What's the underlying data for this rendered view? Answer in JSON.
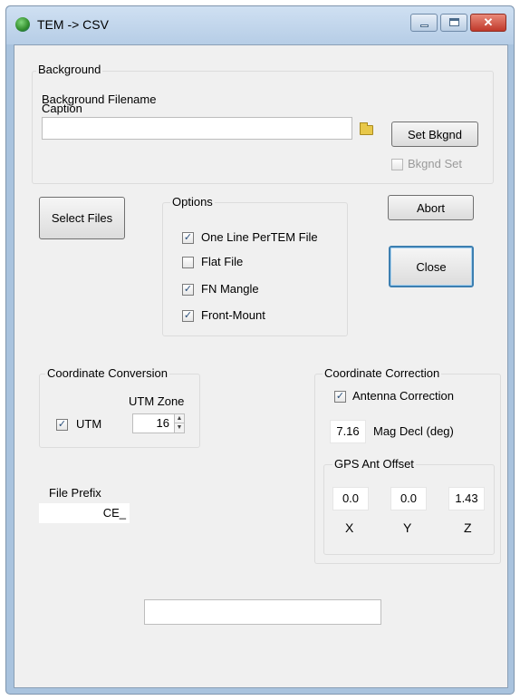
{
  "window": {
    "title": "TEM -> CSV"
  },
  "background": {
    "group_label": "Background",
    "filename_label": "Background Filename",
    "caption_label": "Caption",
    "filename_value": "",
    "set_bkgnd_label": "Set Bkgnd",
    "bkgnd_set_label": "Bkgnd Set",
    "bkgnd_set_checked": false
  },
  "actions": {
    "select_files_label": "Select Files",
    "abort_label": "Abort",
    "close_label": "Close"
  },
  "options": {
    "group_label": "Options",
    "items": [
      {
        "label": "One Line PerTEM File",
        "checked": true
      },
      {
        "label": "Flat File",
        "checked": false
      },
      {
        "label": "FN Mangle",
        "checked": true
      },
      {
        "label": "Front-Mount",
        "checked": true
      }
    ]
  },
  "coord_conversion": {
    "group_label": "Coordinate Conversion",
    "utm_label": "UTM",
    "utm_checked": true,
    "utm_zone_label": "UTM Zone",
    "utm_zone_value": "16"
  },
  "coord_correction": {
    "group_label": "Coordinate Correction",
    "antenna_label": "Antenna Correction",
    "antenna_checked": true,
    "mag_decl_value": "7.16",
    "mag_decl_label": "Mag Decl (deg)",
    "gps_group_label": "GPS Ant Offset",
    "x_value": "0.0",
    "y_value": "0.0",
    "z_value": "1.43",
    "x_label": "X",
    "y_label": "Y",
    "z_label": "Z"
  },
  "file_prefix": {
    "label": "File Prefix",
    "value": "CE_"
  },
  "status": {
    "value": ""
  }
}
